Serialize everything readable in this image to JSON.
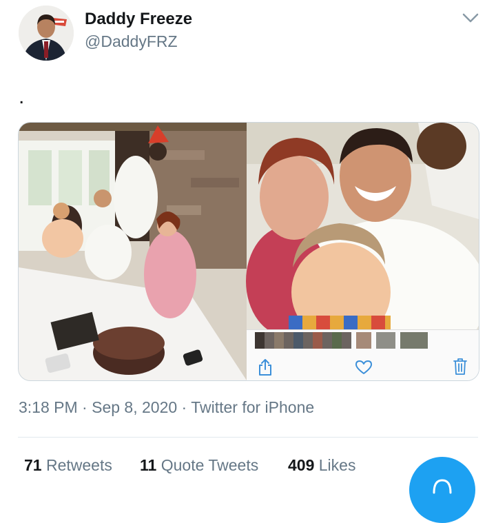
{
  "tweet": {
    "author_name": "Daddy Freeze",
    "author_handle": "@DaddyFRZ",
    "text": ".",
    "time": "3:18 PM",
    "date": "Sep 8, 2020",
    "source": "Twitter for iPhone",
    "separator": " · "
  },
  "stats": {
    "retweets_count": "71",
    "retweets_label": "Retweets",
    "quote_count": "11",
    "quote_label": "Quote Tweets",
    "likes_count": "409",
    "likes_label": "Likes"
  },
  "icons": {
    "menu": "chevron-down-icon",
    "share": "share-icon",
    "like": "heart-icon",
    "delete": "trash-icon",
    "compose": "compose-icon"
  },
  "colors": {
    "accent": "#1da1f2",
    "text_primary": "#14171a",
    "text_secondary": "#657786",
    "ios_icon_blue": "#3b8fd9"
  }
}
